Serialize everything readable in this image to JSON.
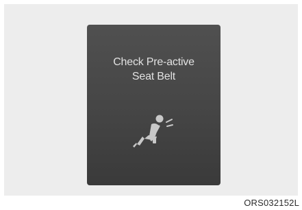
{
  "display": {
    "message_line1": "Check Pre-active",
    "message_line2": "Seat Belt",
    "icon": "seatbelt-warning-icon"
  },
  "figure_code": "ORS032152L",
  "colors": {
    "display_background": "#454545",
    "text": "#e2e2e2",
    "icon": "#c8c8c8"
  }
}
